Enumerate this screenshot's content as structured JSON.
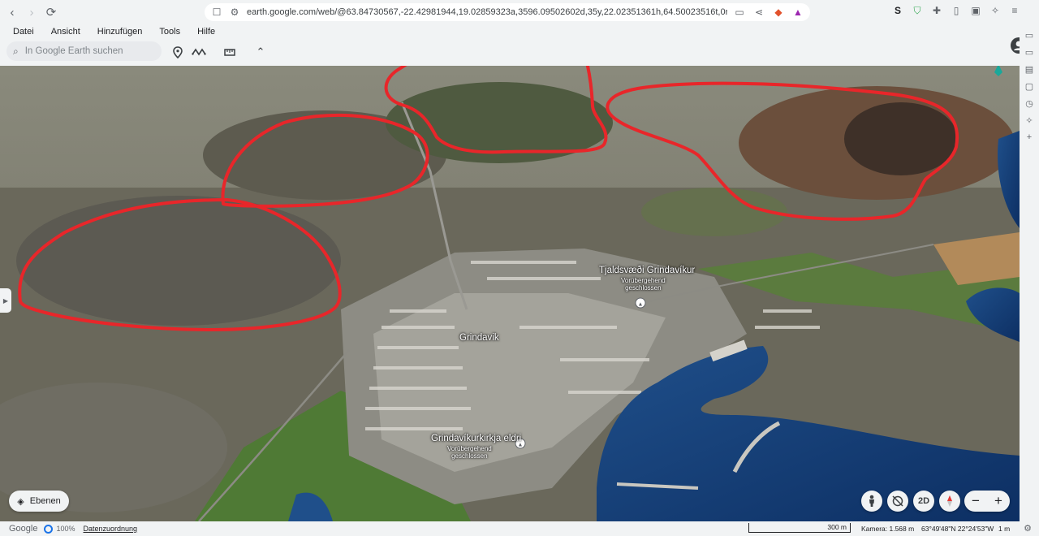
{
  "browser": {
    "url": "earth.google.com/web/@63.84730567,-22.42981944,19.02859323a,3596.09502602d,35y,22.02351361h,64.50023516t,0r",
    "back_icon": "chevron-left-icon",
    "forward_icon": "chevron-right-icon",
    "reload_icon": "reload-icon"
  },
  "menu": {
    "items": [
      "Datei",
      "Ansicht",
      "Hinzufügen",
      "Tools",
      "Hilfe"
    ]
  },
  "toolbar": {
    "search_placeholder": "In Google Earth suchen"
  },
  "map": {
    "labels": {
      "town": "Grindavik",
      "pool": "Tjaldsvæði Grindavíkur",
      "pool_status_1": "Vorübergehend",
      "pool_status_2": "geschlossen",
      "church": "Grindavíkurkirkja eldri",
      "church_status_1": "Vorübergehend",
      "church_status_2": "geschlossen"
    },
    "layers_label": "Ebenen",
    "view_mode": "2D",
    "zoom_out": "−",
    "zoom_in": "+",
    "annotation_color": "#e8262a"
  },
  "status": {
    "brand": "Google",
    "zoom": "100%",
    "attribution": "Datenzuordnung",
    "scale": "300 m",
    "camera": "Kamera: 1.568 m",
    "coordinates": "63°49'48\"N 22°24'53\"W",
    "altitude": "1 m"
  }
}
